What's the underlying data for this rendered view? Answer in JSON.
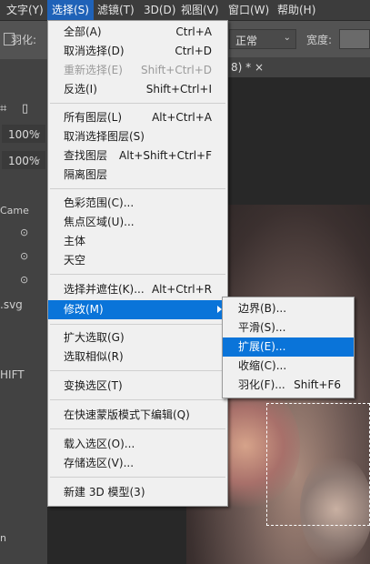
{
  "menubar": {
    "items": [
      "文字(Y)",
      "选择(S)",
      "滤镜(T)",
      "3D(D)",
      "视图(V)",
      "窗口(W)",
      "帮助(H)"
    ]
  },
  "options": {
    "feather_label": "羽化:",
    "style_value": "正常",
    "width_label": "宽度:"
  },
  "doc": {
    "tab_title": "8) * ×"
  },
  "left_panel": {
    "zoom1": "100%",
    "zoom2": "100%",
    "camera_label": "Came",
    "file_label": ".svg",
    "shift_label": "HIFT",
    "bottom_label": "n"
  },
  "select_menu": {
    "items": [
      {
        "label": "全部(A)",
        "shortcut": "Ctrl+A"
      },
      {
        "label": "取消选择(D)",
        "shortcut": "Ctrl+D"
      },
      {
        "label": "重新选择(E)",
        "shortcut": "Shift+Ctrl+D"
      },
      {
        "label": "反选(I)",
        "shortcut": "Shift+Ctrl+I"
      },
      {
        "label": "所有图层(L)",
        "shortcut": "Alt+Ctrl+A"
      },
      {
        "label": "取消选择图层(S)",
        "shortcut": ""
      },
      {
        "label": "查找图层",
        "shortcut": "Alt+Shift+Ctrl+F"
      },
      {
        "label": "隔离图层",
        "shortcut": ""
      },
      {
        "label": "色彩范围(C)...",
        "shortcut": ""
      },
      {
        "label": "焦点区域(U)...",
        "shortcut": ""
      },
      {
        "label": "主体",
        "shortcut": ""
      },
      {
        "label": "天空",
        "shortcut": ""
      },
      {
        "label": "选择并遮住(K)...",
        "shortcut": "Alt+Ctrl+R"
      },
      {
        "label": "修改(M)",
        "shortcut": ""
      },
      {
        "label": "扩大选取(G)",
        "shortcut": ""
      },
      {
        "label": "选取相似(R)",
        "shortcut": ""
      },
      {
        "label": "变换选区(T)",
        "shortcut": ""
      },
      {
        "label": "在快速蒙版模式下编辑(Q)",
        "shortcut": ""
      },
      {
        "label": "载入选区(O)...",
        "shortcut": ""
      },
      {
        "label": "存储选区(V)...",
        "shortcut": ""
      },
      {
        "label": "新建 3D 模型(3)",
        "shortcut": ""
      }
    ]
  },
  "modify_menu": {
    "items": [
      {
        "label": "边界(B)...",
        "shortcut": ""
      },
      {
        "label": "平滑(S)...",
        "shortcut": ""
      },
      {
        "label": "扩展(E)...",
        "shortcut": ""
      },
      {
        "label": "收缩(C)...",
        "shortcut": ""
      },
      {
        "label": "羽化(F)...",
        "shortcut": "Shift+F6"
      }
    ]
  },
  "colors": {
    "highlight": "#0a74d9",
    "menubar_active": "#1f62b8",
    "menu_bg": "#f0f0f0"
  }
}
